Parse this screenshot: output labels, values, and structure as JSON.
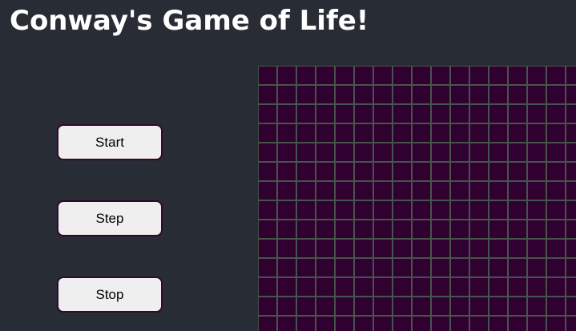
{
  "app": {
    "title": "Conway's Game of Life!"
  },
  "controls": {
    "start_label": "Start",
    "step_label": "Step",
    "stop_label": "Stop"
  },
  "grid": {
    "visible_rows": 14,
    "visible_cols": 17,
    "live_cells": [],
    "dead_color": "#300030",
    "border_color": "#47544a"
  },
  "theme": {
    "background": "#282c34",
    "button_border": "#36062e"
  }
}
